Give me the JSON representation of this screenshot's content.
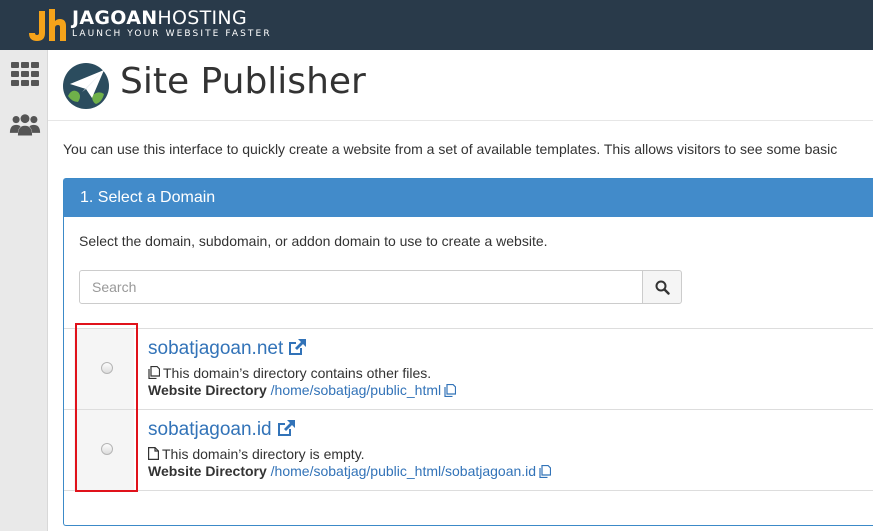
{
  "brand": {
    "name_bold": "JAGOAN",
    "name_light": "HOSTING",
    "tagline": "LAUNCH YOUR WEBSITE FASTER",
    "accent_color": "#f5a31a",
    "bar_color": "#293a4a"
  },
  "sidebar": {
    "items": [
      {
        "icon": "grid-icon"
      },
      {
        "icon": "users-icon"
      }
    ]
  },
  "page": {
    "title": "Site Publisher",
    "intro": "You can use this interface to quickly create a website from a set of available templates. This allows visitors to see some basic"
  },
  "panel": {
    "heading": "1. Select a Domain",
    "description": "Select the domain, subdomain, or addon domain to use to create a website.",
    "heading_color": "#428bca"
  },
  "search": {
    "placeholder": "Search",
    "value": ""
  },
  "domains": [
    {
      "name": "sobatjagoan.net",
      "status": "This domain’s directory contains other files.",
      "dir_label": "Website Directory",
      "dir_path": "/home/sobatjag/public_html"
    },
    {
      "name": "sobatjagoan.id",
      "status": "This domain’s directory is empty.",
      "dir_label": "Website Directory",
      "dir_path": "/home/sobatjag/public_html/sobatjagoan.id"
    }
  ],
  "colors": {
    "link": "#3273b8",
    "highlight": "#e0121b"
  }
}
